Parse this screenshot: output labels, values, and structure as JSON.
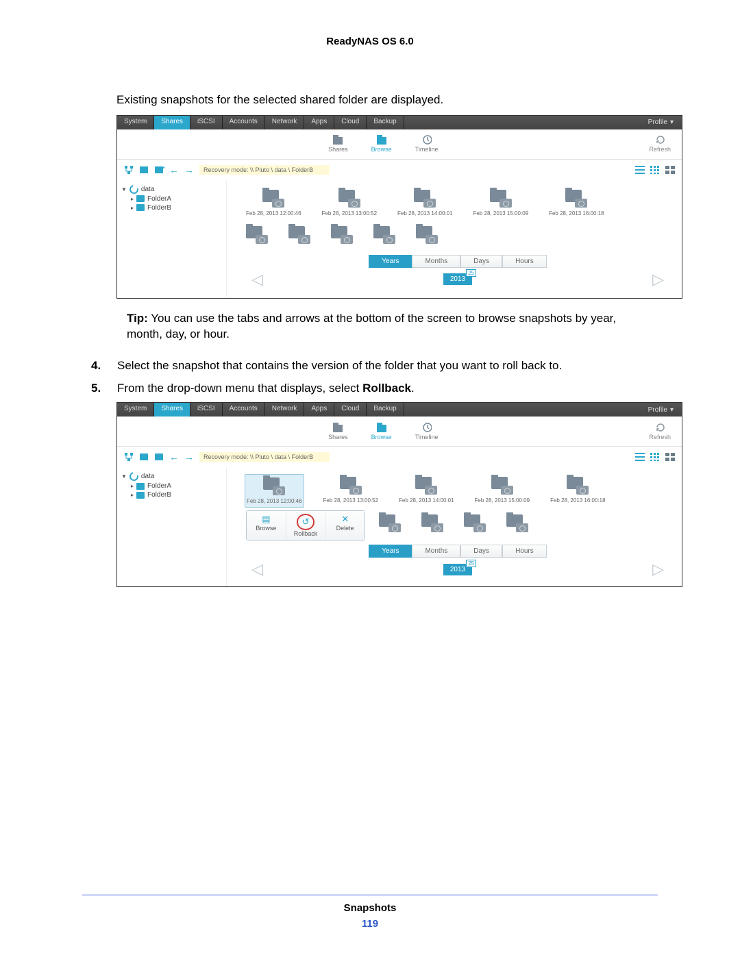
{
  "doc": {
    "header": "ReadyNAS OS 6.0",
    "intro": "Existing snapshots for the selected shared folder are displayed.",
    "tip_label": "Tip:",
    "tip_text": "You can use the tabs and arrows at the bottom of the screen to browse snapshots by year, month, day, or hour.",
    "step4": "Select the snapshot that contains the version of the folder that you want to roll back to.",
    "step5_a": "From the drop-down menu that displays, select ",
    "step5_b": "Rollback",
    "step5_c": ".",
    "footer_title": "Snapshots",
    "footer_page": "119"
  },
  "ui": {
    "topnav": [
      "System",
      "Shares",
      "iSCSI",
      "Accounts",
      "Network",
      "Apps",
      "Cloud",
      "Backup"
    ],
    "active_tab": "Shares",
    "profile": "Profile",
    "subicons": {
      "shares": "Shares",
      "browse": "Browse",
      "timeline": "Timeline",
      "refresh": "Refresh"
    },
    "breadcrumb_prefix": "Recovery mode:",
    "breadcrumb_path": "\\\\ Pluto \\ data \\ FolderB",
    "tree": {
      "root": "data",
      "children": [
        "FolderA",
        "FolderB"
      ]
    },
    "snapshots": [
      "Feb 28, 2013 12:00:46",
      "Feb 28, 2013 13:00:52",
      "Feb 28, 2013 14:00:01",
      "Feb 28, 2013 15:00:09",
      "Feb 28, 2013 16:00:18"
    ],
    "context_menu": {
      "browse": "Browse",
      "rollback": "Rollback",
      "delete": "Delete"
    },
    "range_tabs": [
      "Years",
      "Months",
      "Days",
      "Hours"
    ],
    "active_range": "Years",
    "year": "2013",
    "year_count": "25"
  }
}
